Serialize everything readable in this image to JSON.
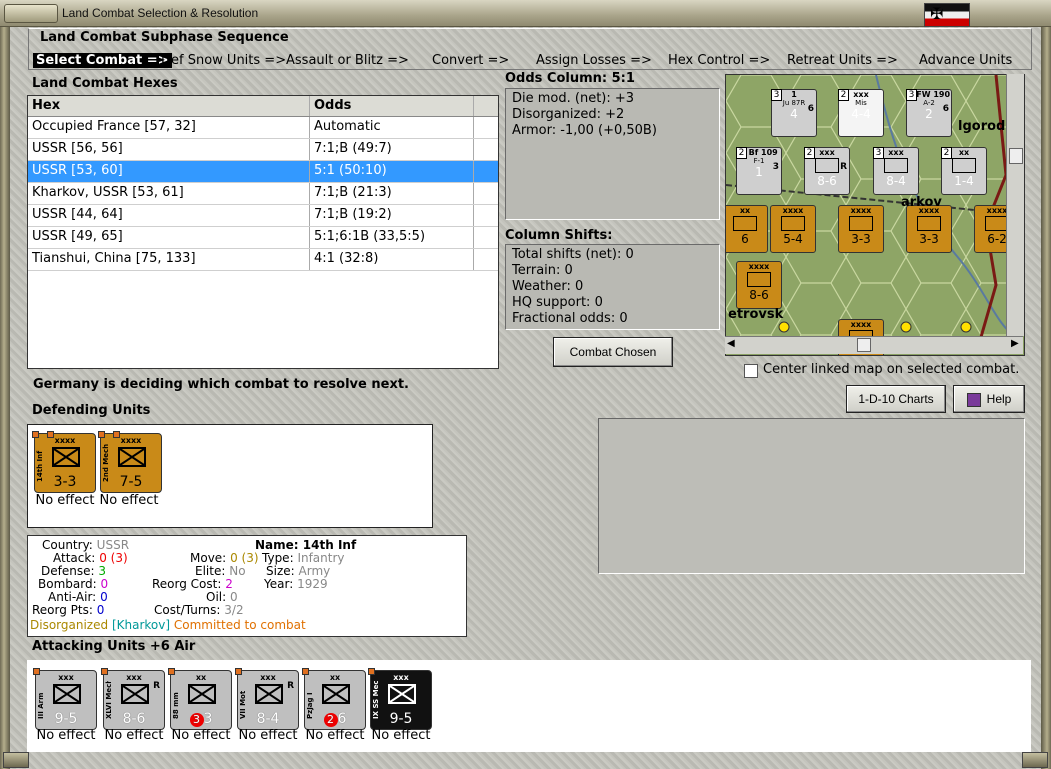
{
  "window": {
    "title": "Land Combat Selection & Resolution"
  },
  "subphase": {
    "title": "Land Combat Subphase Sequence",
    "steps": [
      "Select Combat =>",
      "Def Snow Units =>",
      "Assault or Blitz =>",
      "Convert =>",
      "Assign Losses =>",
      "Hex Control =>",
      "Retreat Units =>",
      "Advance Units"
    ],
    "active_step": "Select Combat =>"
  },
  "hexes": {
    "label": "Land Combat Hexes",
    "columns": [
      "Hex",
      "Odds"
    ],
    "rows": [
      {
        "hex": "Occupied France [57, 32]",
        "odds": "Automatic"
      },
      {
        "hex": "USSR [56, 56]",
        "odds": "7:1;B (49:7)"
      },
      {
        "hex": "USSR [53, 60]",
        "odds": "5:1 (50:10)"
      },
      {
        "hex": "Kharkov, USSR [53, 61]",
        "odds": "7:1;B (21:3)"
      },
      {
        "hex": "USSR [44, 64]",
        "odds": "7:1;B (19:2)"
      },
      {
        "hex": "USSR [49, 65]",
        "odds": "5:1;6:1B (33,5:5)"
      },
      {
        "hex": "Tianshui, China [75, 133]",
        "odds": "4:1 (32:8)"
      }
    ],
    "selected_row": 2
  },
  "odds": {
    "label": "Odds Column: 5:1",
    "lines": [
      "Die mod. (net): +3",
      "Disorganized: +2",
      "Armor: -1,00 (+0,50B)"
    ]
  },
  "shifts": {
    "label": "Column Shifts:",
    "lines": [
      "Total shifts (net): 0",
      "Terrain: 0",
      "Weather: 0",
      "HQ support: 0",
      "Fractional odds: 0"
    ]
  },
  "buttons": {
    "combat_chosen": "Combat Chosen",
    "charts": "1-D-10 Charts",
    "help": "Help"
  },
  "map": {
    "labels": [
      "lgorod",
      "arkov",
      "etrovsk"
    ]
  },
  "map_units": [
    {
      "top": "1",
      "mid": "Ju 87R",
      "val": "4",
      "r": "6",
      "t": "3"
    },
    {
      "top": "xxx",
      "mid": "Mis",
      "val": "4-4",
      "t": "2"
    },
    {
      "top": "7 FW 190",
      "mid": "A-2",
      "val": "2",
      "r": "6",
      "t": "3"
    },
    {
      "top": "5 Bf 109",
      "mid": "F-1",
      "val": "1",
      "r": "3",
      "t": "2"
    },
    {
      "top": "xxx",
      "val": "8-6",
      "r": "R",
      "t": "2"
    },
    {
      "top": "xxx",
      "val": "8-4",
      "t": "3"
    },
    {
      "top": "xx",
      "val": "1-4",
      "t": "2"
    },
    {
      "top": "xx",
      "val": "6"
    },
    {
      "top": "xxxx",
      "val": "5-4"
    },
    {
      "top": "xxxx",
      "val": "3-3"
    },
    {
      "top": "xxxx",
      "val": "3-3"
    },
    {
      "top": "xxxx",
      "val": "6-2"
    },
    {
      "top": "xxxx",
      "val": "8-6"
    },
    {
      "top": "xxxx",
      "val": ""
    }
  ],
  "center_map": {
    "label": "Center linked map on selected combat.",
    "checked": false
  },
  "status": "Germany is deciding which combat to resolve next.",
  "defending": {
    "label": "Defending Units",
    "units": [
      {
        "name": "14th Inf",
        "size": "xxxx",
        "value": "3-3",
        "effect": "No effect"
      },
      {
        "name": "2nd Mech",
        "size": "xxxx",
        "value": "7-5",
        "effect": "No effect"
      }
    ]
  },
  "unit_info": {
    "country_label": "Country:",
    "country": "USSR",
    "attack_label": "Attack:",
    "attack": "0",
    "attack_mod": "(3)",
    "defense_label": "Defense:",
    "defense": "3",
    "bombard_label": "Bombard:",
    "bombard": "0",
    "antiair_label": "Anti-Air:",
    "antiair": "0",
    "reorg_pts_label": "Reorg Pts:",
    "reorg_pts": "0",
    "move_label": "Move:",
    "move": "0",
    "move_mod": "(3)",
    "elite_label": "Elite:",
    "elite": "No",
    "reorg_cost_label": "Reorg Cost:",
    "reorg_cost": "2",
    "oil_label": "Oil:",
    "oil": "0",
    "cost_turns_label": "Cost/Turns:",
    "cost_turns": "3/2",
    "name_label": "Name:",
    "name": "14th Inf",
    "type_label": "Type:",
    "type": "Infantry",
    "size_label": "Size:",
    "size": "Army",
    "year_label": "Year:",
    "year": "1929",
    "disorg": "Disorganized",
    "location": "[Kharkov]",
    "committed": "Committed to combat"
  },
  "attacking": {
    "label": "Attacking Units +6 Air",
    "units": [
      {
        "name": "III Arm",
        "size": "xxx",
        "value": "9-5",
        "effect": "No effect",
        "mark": ""
      },
      {
        "name": "XLVI Mech",
        "size": "xxx",
        "value": "8-6",
        "effect": "No effect",
        "mark": "R"
      },
      {
        "name": "88 mm",
        "size": "xx",
        "value": "3",
        "badge": "3",
        "effect": "No effect",
        "mark": ""
      },
      {
        "name": "VII Mot",
        "size": "xxx",
        "value": "8-4",
        "effect": "No effect",
        "mark": "R"
      },
      {
        "name": "PzJag I",
        "size": "xx",
        "value": "6",
        "badge": "2",
        "effect": "No effect",
        "mark": ""
      },
      {
        "name": "IX SS Mech",
        "size": "xxx",
        "value": "9-5",
        "effect": "No effect",
        "mark": ""
      }
    ]
  },
  "colors": {
    "selection": "#3399ff",
    "soviet_counter": "#c98a18",
    "german_counter": "#bfbfbf",
    "ss_counter": "#111111"
  }
}
